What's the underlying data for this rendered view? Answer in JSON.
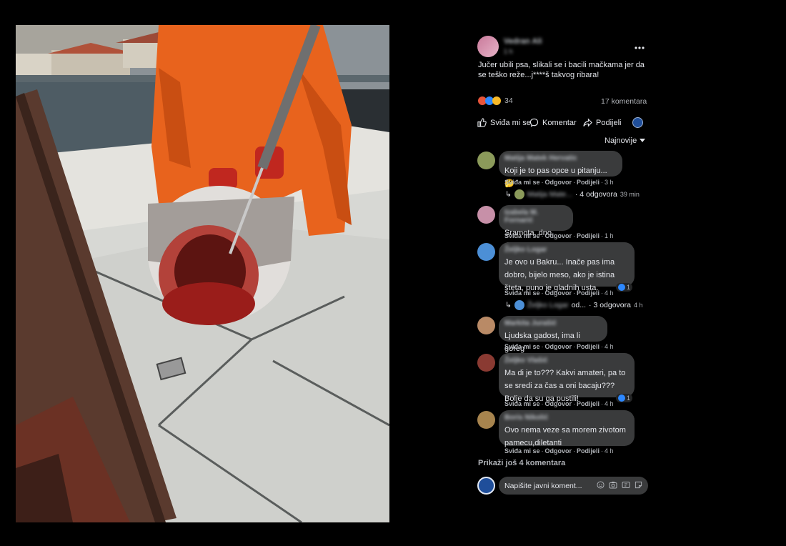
{
  "post": {
    "author": "Vedran Ali",
    "time": "1 h",
    "text": "Jučer ubili psa, slikali se i bacili mačkama jer da se teško reže...j****š takvog ribara!",
    "reaction_count": "34",
    "comments_count": "17 komentara",
    "actions": {
      "like": "Sviđa mi se",
      "comment": "Komentar",
      "share": "Podijeli"
    },
    "sort_label": "Najnovije"
  },
  "comments": [
    {
      "name": "Matija Matek Hervatic",
      "text": "Koji je to pas opce u pitanju... 🤔",
      "like": "Sviđa mi se",
      "reply": "Odgovor",
      "share": "Podijeli",
      "time": "3 h",
      "replies": {
        "name": "Matija Mate...",
        "count": "· 4 odgovora",
        "time": "39 min"
      }
    },
    {
      "name": "Izabela M. Fornarić",
      "text": "Sramota, dno dna.",
      "like": "Sviđa mi se",
      "reply": "Odgovor",
      "share": "Podijeli",
      "time": "1 h"
    },
    {
      "name": "Željko Logar",
      "text": "Je ovo u Bakru... Inače pas ima dobro, bijelo meso, ako je istina šteta, puno je gladnih usta.",
      "like": "Sviđa mi se",
      "reply": "Odgovor",
      "share": "Podijeli",
      "time": "4 h",
      "reactions": "1",
      "replies": {
        "name": "Željko Logar",
        "suffix": "od...",
        "count": "· 3 odgovora",
        "time": "4 h"
      }
    },
    {
      "name": "Markita Jurašić",
      "text": "Ljudska gadost, ima li goreg",
      "like": "Sviđa mi se",
      "reply": "Odgovor",
      "share": "Podijeli",
      "time": "4 h"
    },
    {
      "name": "Željko Vlašić",
      "text": "Ma di je to??? Kakvi amateri, pa to se sredi za čas a oni bacaju??? Bolje da su ga pustili!",
      "like": "Sviđa mi se",
      "reply": "Odgovor",
      "share": "Podijeli",
      "time": "4 h",
      "reactions": "1"
    },
    {
      "name": "Boris Nikolić",
      "text": "Ovo nema veze sa morem zivotom pamecu,diletanti",
      "like": "Sviđa mi se",
      "reply": "Odgovor",
      "share": "Podijeli",
      "time": "4 h"
    }
  ],
  "more_comments": "Prikaži još 4 komentara",
  "composer": {
    "placeholder": "Napišite javni koment..."
  },
  "colors": {
    "bg": "#000000",
    "bubble": "#3a3b3c",
    "text": "#e4e6eb",
    "muted": "#b0b3b8",
    "jacket": "#e8631d",
    "blood": "#8f1a1a"
  },
  "icons": [
    "more-icon",
    "angry-reaction-icon",
    "like-reaction-icon",
    "sad-reaction-icon",
    "like-icon",
    "comment-icon",
    "share-icon",
    "page-avatar-icon",
    "chevron-down-icon",
    "reply-arrow-icon",
    "emoji-icon",
    "camera-icon",
    "gif-icon",
    "sticker-icon"
  ]
}
